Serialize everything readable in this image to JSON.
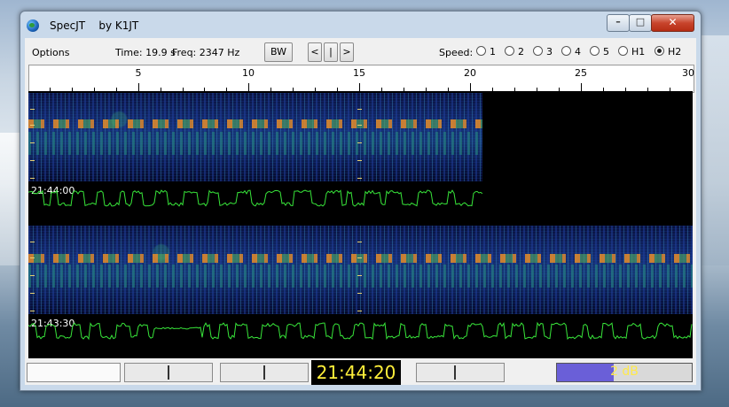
{
  "window": {
    "title": "SpecJT    by K1JT"
  },
  "toolbar": {
    "options_label": "Options",
    "time_text": "Time: 19.9 s",
    "freq_text": "Freq: 2347 Hz",
    "bw_label": "BW",
    "prev_label": "<",
    "mid_label": "|",
    "next_label": ">",
    "speed_label": "Speed:",
    "speed_options": [
      "1",
      "2",
      "3",
      "4",
      "5",
      "H1",
      "H2"
    ],
    "speed_selected": "H2"
  },
  "ruler": {
    "labels": [
      "5",
      "10",
      "15",
      "20",
      "25",
      "30"
    ]
  },
  "spectrogram": {
    "rows": [
      {
        "time_label": "21:44:00"
      },
      {
        "time_label": "21:43:30"
      }
    ],
    "colors": {
      "trace": "#38e63a",
      "marker": "#e8d070"
    }
  },
  "status": {
    "clock": "21:44:20",
    "level_text": "2 dB",
    "level_fraction": 0.42,
    "colors": {
      "clock_text": "#ffef3a",
      "level_fill": "#6a5fd8",
      "level_text": "#ffe94a"
    }
  }
}
